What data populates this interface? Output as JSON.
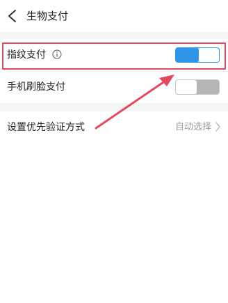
{
  "header": {
    "back_icon": "chevron-left-icon",
    "title": "生物支付"
  },
  "settings": {
    "fingerprint": {
      "label": "指纹支付",
      "info_icon": "info-circle-icon",
      "enabled": true
    },
    "face": {
      "label": "手机刷脸支付",
      "enabled": false
    },
    "priority": {
      "label": "设置优先验证方式",
      "value": "自动选择",
      "chevron_icon": "chevron-right-icon"
    }
  },
  "annotation": {
    "highlight_color": "#e34a5e",
    "arrow_color": "#e34a5e"
  },
  "colors": {
    "toggle_on": "#2f95e8",
    "toggle_off": "#b5b5b5",
    "background": "#f5f5f5"
  }
}
